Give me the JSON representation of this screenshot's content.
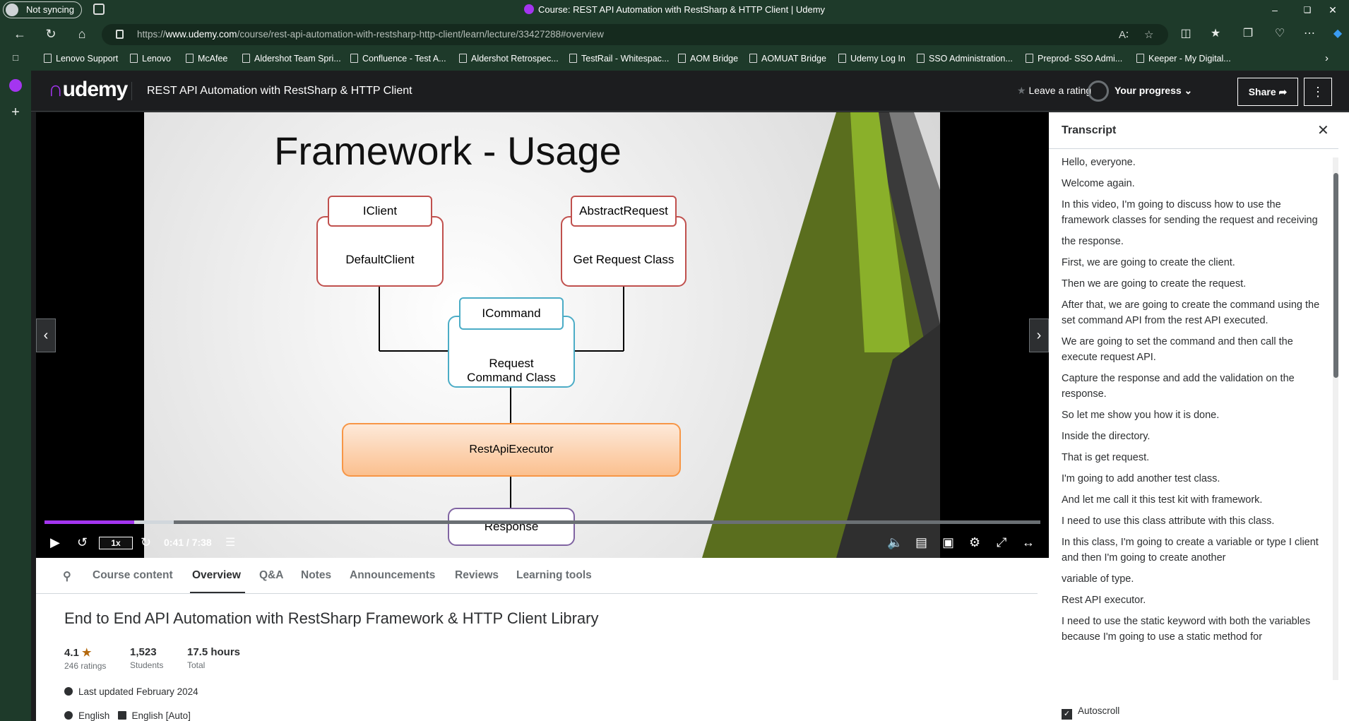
{
  "window": {
    "title": "Course: REST API Automation with RestSharp & HTTP Client | Udemy",
    "sync_label": "Not syncing"
  },
  "browser": {
    "url_domain": "www.udemy.com",
    "url_prefix": "https://",
    "url_path": "/course/rest-api-automation-with-restsharp-http-client/learn/lecture/33427288#overview"
  },
  "bookmarks": [
    "Lenovo Support",
    "Lenovo",
    "McAfee",
    "Aldershot Team Spri...",
    "Confluence - Test A...",
    "Aldershot Retrospec...",
    "TestRail - Whitespac...",
    "AOM Bridge",
    "AOMUAT Bridge",
    "Udemy Log In",
    "SSO Administration...",
    "Preprod- SSO Admi...",
    "Keeper - My Digital..."
  ],
  "header": {
    "logo": "udemy",
    "course_title": "REST API Automation with RestSharp & HTTP Client",
    "rate_label": "Leave a rating",
    "progress_label": "Your progress",
    "share_label": "Share"
  },
  "slide": {
    "title": "Framework - Usage",
    "boxes": {
      "iclient": "IClient",
      "default_client": "DefaultClient",
      "abstract_request": "AbstractRequest",
      "get_request": "Get Request Class",
      "icommand": "ICommand",
      "request_command": "Request Command Class",
      "executor": "RestApiExecutor",
      "response": "Response"
    }
  },
  "player": {
    "speed": "1x",
    "time": "0:41 / 7:38",
    "progress_fraction": 0.09,
    "buffered_fraction": 0.13
  },
  "tabs": [
    "Course content",
    "Overview",
    "Q&A",
    "Notes",
    "Announcements",
    "Reviews",
    "Learning tools"
  ],
  "overview": {
    "title": "End to End API Automation with RestSharp Framework & HTTP Client Library",
    "rating": "4.1",
    "ratings_label": "246 ratings",
    "students": "1,523",
    "students_label": "Students",
    "hours": "17.5 hours",
    "hours_label": "Total",
    "last_updated": "Last updated February 2024",
    "language": "English",
    "captions": "English [Auto]"
  },
  "transcript": {
    "title": "Transcript",
    "lines": [
      "Hello, everyone.",
      "Welcome again.",
      "In this video, I'm going to discuss how to use the framework classes for sending the request and receiving",
      "the response.",
      "First, we are going to create the client.",
      "Then we are going to create the request.",
      "After that, we are going to create the command using the set command API from the rest API executed.",
      "We are going to set the command and then call the execute request API.",
      "Capture the response and add the validation on the response.",
      "So let me show you how it is done.",
      "Inside the directory.",
      "That is get request.",
      "I'm going to add another test class.",
      "And let me call it this test kit with framework.",
      "I need to use this class attribute with this class.",
      "In this class, I'm going to create a variable or type I client and then I'm going to create another",
      "variable of type.",
      "Rest API executor.",
      "I need to use the static keyword with both the variables because I'm going to use a static method for"
    ],
    "autoscroll_label": "Autoscroll"
  }
}
